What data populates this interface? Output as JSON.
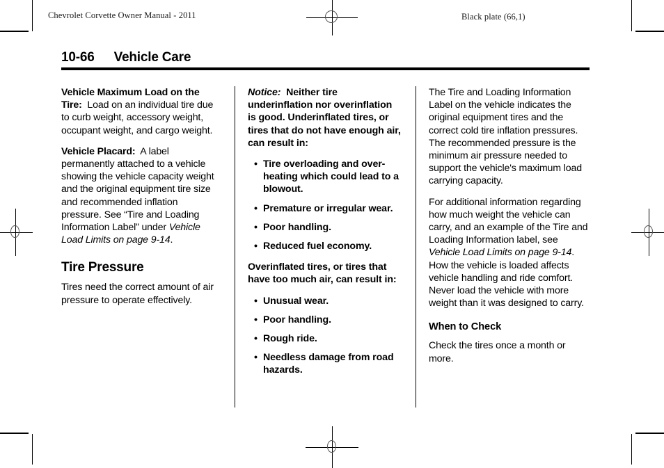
{
  "header": {
    "manual_title": "Chevrolet Corvette Owner Manual - 2011",
    "black_plate": "Black plate (66,1)"
  },
  "page": {
    "number": "10-66",
    "chapter_title": "Vehicle Care"
  },
  "columns": {
    "col1": {
      "para1": {
        "lead": "Vehicle Maximum Load on the Tire:",
        "body": "Load on an individual tire due to curb weight, accessory weight, occupant weight, and cargo weight."
      },
      "para2": {
        "lead": "Vehicle Placard:",
        "body_a": "A label permanently attached to a vehicle showing the vehicle capacity weight and the original equipment tire size and recommended inflation pressure. See “Tire and Loading Information Label” under ",
        "ref": "Vehicle Load Limits on page 9-14",
        "body_b": "."
      },
      "heading": "Tire Pressure",
      "para3": "Tires need the correct amount of air pressure to operate effectively."
    },
    "col2": {
      "notice_label": "Notice:",
      "notice_body": "Neither tire underinflation nor overinflation is good. Underinflated tires, or tires that do not have enough air, can result in:",
      "under_bullets": [
        "Tire overloading and over-heating which could lead to a blowout.",
        "Premature or irregular wear.",
        "Poor handling.",
        "Reduced fuel economy."
      ],
      "over_intro": "Overinflated tires, or tires that have too much air, can result in:",
      "over_bullets": [
        "Unusual wear.",
        "Poor handling.",
        "Rough ride.",
        "Needless damage from road hazards."
      ],
      "bullet_glyph": "•"
    },
    "col3": {
      "para1": "The Tire and Loading Information Label on the vehicle indicates the original equipment tires and the correct cold tire inflation pressures. The recommended pressure is the minimum air pressure needed to support the vehicle's maximum load carrying capacity.",
      "para2_a": "For additional information regarding how much weight the vehicle can carry, and an example of the Tire and Loading Information label, see ",
      "para2_ref": "Vehicle Load Limits on page 9-14",
      "para2_b": ". How the vehicle is loaded affects vehicle handling and ride comfort. Never load the vehicle with more weight than it was designed to carry.",
      "heading": "When to Check",
      "para3": "Check the tires once a month or more."
    }
  }
}
